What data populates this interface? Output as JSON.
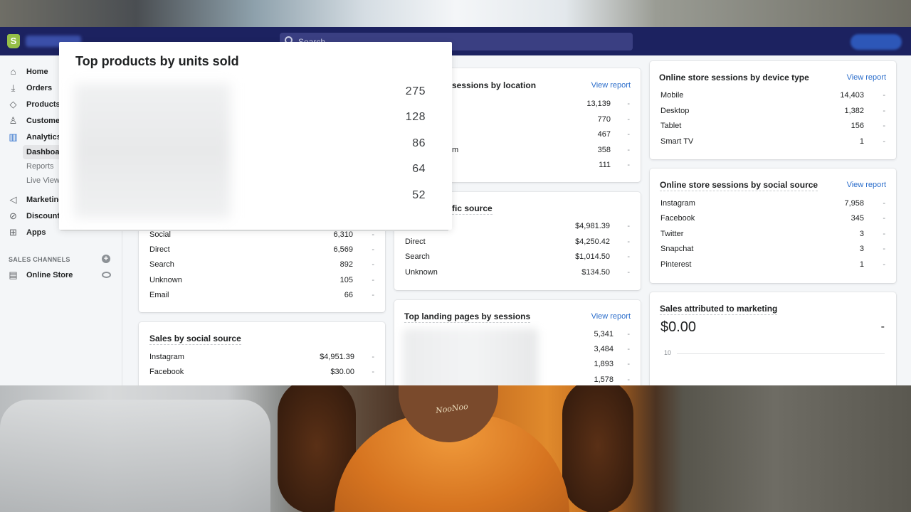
{
  "topbar": {
    "logo": "S",
    "search_placeholder": "Search"
  },
  "sidebar": {
    "items": [
      {
        "label": "Home",
        "icon": "home-icon",
        "glyph": "⌂"
      },
      {
        "label": "Orders",
        "icon": "orders-icon",
        "glyph": "⤓"
      },
      {
        "label": "Products",
        "icon": "tag-icon",
        "glyph": "◇"
      },
      {
        "label": "Customers",
        "icon": "person-icon",
        "glyph": "♙"
      },
      {
        "label": "Analytics",
        "icon": "bar-chart-icon",
        "glyph": "▥"
      }
    ],
    "analytics_sub": [
      "Dashboards",
      "Reports",
      "Live View"
    ],
    "items2": [
      {
        "label": "Marketing",
        "icon": "megaphone-icon",
        "glyph": "◁"
      },
      {
        "label": "Discounts",
        "icon": "discount-icon",
        "glyph": "⊘"
      },
      {
        "label": "Apps",
        "icon": "apps-icon",
        "glyph": "⊞"
      }
    ],
    "sales_channels_label": "SALES CHANNELS",
    "online_store_label": "Online Store"
  },
  "overlay": {
    "title": "Top products by units sold",
    "values": [
      "275",
      "128",
      "86",
      "64",
      "52"
    ]
  },
  "col1": {
    "traffic_rows": [
      {
        "label": "Social",
        "value": "6,310",
        "dash": "-"
      },
      {
        "label": "Direct",
        "value": "6,569",
        "dash": "-"
      },
      {
        "label": "Search",
        "value": "892",
        "dash": "-"
      },
      {
        "label": "Unknown",
        "value": "105",
        "dash": "-"
      },
      {
        "label": "Email",
        "value": "66",
        "dash": "-"
      }
    ],
    "social_title": "Sales by social source",
    "social_rows": [
      {
        "label": "Instagram",
        "value": "$4,951.39",
        "dash": "-"
      },
      {
        "label": "Facebook",
        "value": "$30.00",
        "dash": "-"
      }
    ]
  },
  "col2": {
    "location_title": "sessions by location",
    "view_report": "View report",
    "location_rows": [
      {
        "label": "",
        "value": "13,139",
        "dash": "-"
      },
      {
        "label": "",
        "value": "770",
        "dash": "-"
      },
      {
        "label": "",
        "value": "467",
        "dash": "-"
      },
      {
        "label": "m",
        "value": "358",
        "dash": "-"
      },
      {
        "label": "",
        "value": "111",
        "dash": "-"
      }
    ],
    "traffic_title": "fic source",
    "traffic_rows": [
      {
        "label": "",
        "value": "$4,981.39",
        "dash": "-"
      },
      {
        "label": "Direct",
        "value": "$4,250.42",
        "dash": "-"
      },
      {
        "label": "Search",
        "value": "$1,014.50",
        "dash": "-"
      },
      {
        "label": "Unknown",
        "value": "$134.50",
        "dash": "-"
      }
    ],
    "landing_title": "Top landing pages by sessions",
    "landing_rows": [
      {
        "value": "5,341",
        "dash": "-"
      },
      {
        "value": "3,484",
        "dash": "-"
      },
      {
        "value": "1,893",
        "dash": "-"
      },
      {
        "value": "1,578",
        "dash": "-"
      }
    ]
  },
  "col3": {
    "device_title": "Online store sessions by device type",
    "view_report": "View report",
    "device_rows": [
      {
        "label": "Mobile",
        "value": "14,403",
        "dash": "-"
      },
      {
        "label": "Desktop",
        "value": "1,382",
        "dash": "-"
      },
      {
        "label": "Tablet",
        "value": "156",
        "dash": "-"
      },
      {
        "label": "Smart TV",
        "value": "1",
        "dash": "-"
      }
    ],
    "social_title": "Online store sessions by social source",
    "social_rows": [
      {
        "label": "Instagram",
        "value": "7,958",
        "dash": "-"
      },
      {
        "label": "Facebook",
        "value": "345",
        "dash": "-"
      },
      {
        "label": "Twitter",
        "value": "3",
        "dash": "-"
      },
      {
        "label": "Snapchat",
        "value": "3",
        "dash": "-"
      },
      {
        "label": "Pinterest",
        "value": "1",
        "dash": "-"
      }
    ],
    "marketing_title": "Sales attributed to marketing",
    "marketing_value": "$0.00",
    "marketing_dash": "-",
    "marketing_axis": "10"
  },
  "video": {
    "necklace_text": "NooNoo"
  }
}
